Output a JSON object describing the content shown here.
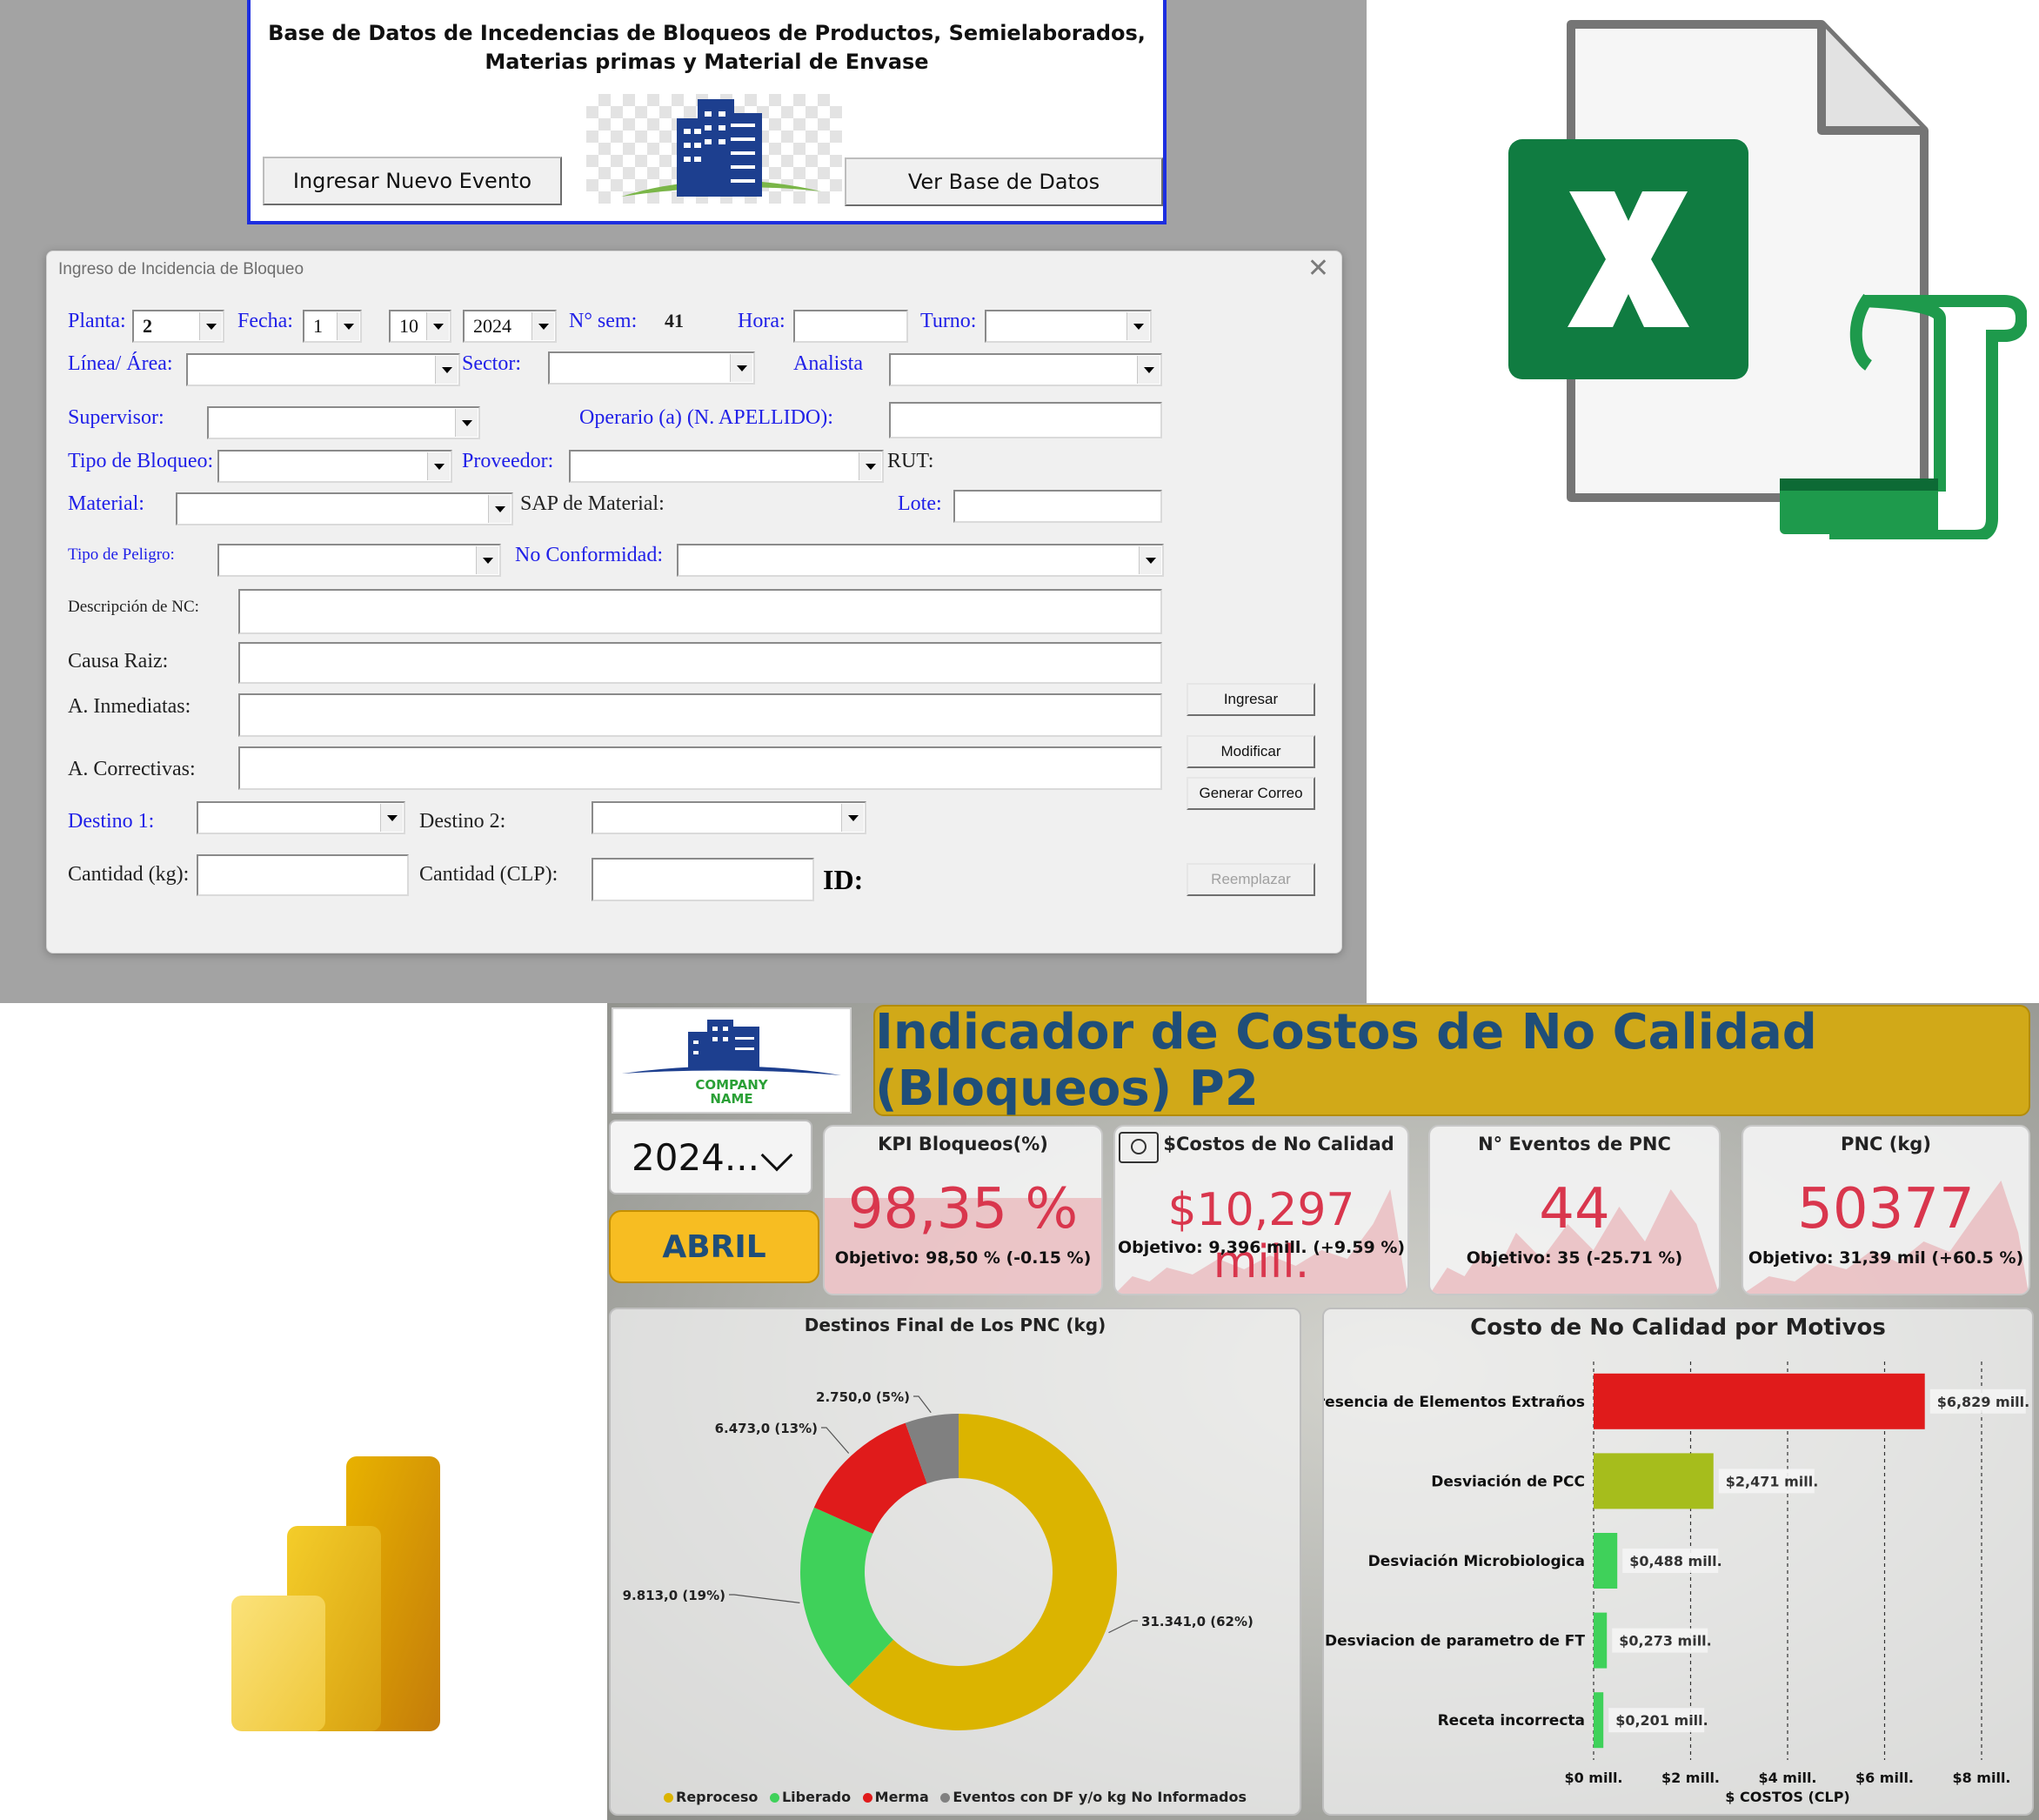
{
  "excel_header": {
    "title": "Base de Datos de Incedencias de Bloqueos de Productos, Semielaborados, Materias primas y Material de Envase",
    "btn_new": "Ingresar Nuevo Evento",
    "btn_view": "Ver Base de Datos"
  },
  "form": {
    "title": "Ingreso de Incidencia de Bloqueo",
    "close": "✕",
    "labels": {
      "planta": "Planta:",
      "fecha": "Fecha:",
      "nsem": "N° sem:",
      "hora": "Hora:",
      "turno": "Turno:",
      "linea": "Línea/ Área:",
      "sector": "Sector:",
      "analista": "Analista",
      "supervisor": "Supervisor:",
      "operario": "Operario (a)   (N. APELLIDO):",
      "tipo_bloqueo": "Tipo de Bloqueo:",
      "proveedor": "Proveedor:",
      "rut": "RUT:",
      "material": "Material:",
      "sap": "SAP de Material:",
      "lote": "Lote:",
      "tipo_peligro": "Tipo de Peligro:",
      "no_conformidad": "No Conformidad:",
      "descripcion": "Descripción de NC:",
      "causa": "Causa Raiz:",
      "inmediatas": "A. Inmediatas:",
      "correctivas": "A. Correctivas:",
      "destino1": "Destino 1:",
      "destino2": "Destino 2:",
      "cantidad_kg": "Cantidad (kg):",
      "cantidad_clp": "Cantidad (CLP):",
      "id": "ID:"
    },
    "values": {
      "planta": "2",
      "dia": "1",
      "mes": "10",
      "anio": "2024",
      "nsem": "41"
    },
    "buttons": {
      "ingresar": "Ingresar",
      "modificar": "Modificar",
      "correo": "Generar Correo",
      "reemplazar": "Reemplazar"
    }
  },
  "icons": {
    "excel": "excel-file-icon",
    "powerbi": "power-bi-icon"
  },
  "dashboard": {
    "title": "Indicador de Costos de No Calidad (Bloqueos) P2",
    "logo_text_1": "COMPANY",
    "logo_text_2": "NAME",
    "year": "2024...",
    "month": "ABRIL",
    "kpis": [
      {
        "title": "KPI Bloqueos(%)",
        "value": "98,35 %",
        "goal": "Objetivo: 98,50 % (-0.15 %)"
      },
      {
        "title": "$Costos de No Calidad",
        "value": "$10,297 mill.",
        "goal": "Objetivo: 9,396 mill. (+9.59 %)"
      },
      {
        "title": "N° Eventos de PNC",
        "value": "44",
        "goal": "Objetivo: 35 (-25.71 %)"
      },
      {
        "title": "PNC (kg)",
        "value": "50377",
        "goal": "Objetivo: 31,39 mil (+60.5 %)"
      }
    ],
    "accent_color": "#d9364d"
  },
  "chart_data": [
    {
      "type": "pie",
      "title": "Destinos Final de Los PNC (kg)",
      "categories": [
        "Reproceso",
        "Liberado",
        "Merma",
        "Eventos con DF y/o kg No Informados"
      ],
      "values": [
        31341,
        9813,
        6473,
        2750
      ],
      "data_labels": [
        "31.341,0 (62%)",
        "9.813,0 (19%)",
        "6.473,0 (13%)",
        "2.750,0 (5%)"
      ],
      "colors": [
        "#dbb400",
        "#3fd15a",
        "#e01b1b",
        "#808080"
      ],
      "legend": "bottom"
    },
    {
      "type": "bar",
      "title": "Costo de No Calidad por Motivos",
      "categories": [
        "Presencia de Elementos Extraños",
        "Desviación de PCC",
        "Desviación Microbiologica",
        "Desviacion de parametro de FT",
        "Receta incorrecta"
      ],
      "values": [
        6.829,
        2.471,
        0.488,
        0.273,
        0.201
      ],
      "data_labels": [
        "$6,829 mill.",
        "$2,471 mill.",
        "$0,488 mill.",
        "$0,273 mill.",
        "$0,201 mill."
      ],
      "colors": [
        "#e01b1b",
        "#a6bd1c",
        "#3fd15a",
        "#3fd15a",
        "#3fd15a"
      ],
      "xlabel": "$ COSTOS (CLP)",
      "xlim": [
        0,
        8
      ],
      "ticks": [
        "$0 mill.",
        "$2 mill.",
        "$4 mill.",
        "$6 mill.",
        "$8 mill."
      ]
    }
  ]
}
